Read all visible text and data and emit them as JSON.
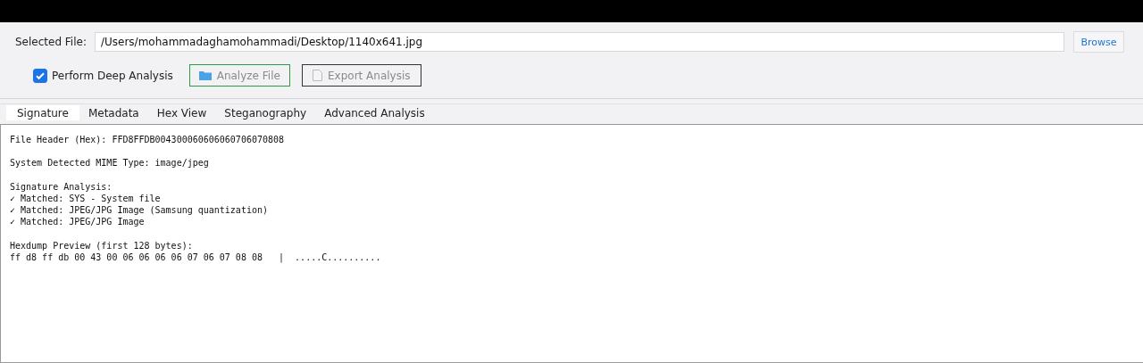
{
  "file_row": {
    "label": "Selected File:",
    "value": "/Users/mohammadaghamohammadi/Desktop/1140x641.jpg",
    "browse_button": "Browse"
  },
  "options_row": {
    "deep_analysis": {
      "label": "Perform Deep Analysis",
      "checked": true
    },
    "buttons": [
      {
        "label": "Analyze File",
        "kind": "analyze"
      },
      {
        "label": "Export Analysis",
        "kind": "export"
      }
    ]
  },
  "tabs": [
    {
      "label": "Signature",
      "selected": true
    },
    {
      "label": "Metadata",
      "selected": false
    },
    {
      "label": "Hex View",
      "selected": false
    },
    {
      "label": "Steganography",
      "selected": false
    },
    {
      "label": "Advanced Analysis",
      "selected": false
    }
  ],
  "output": {
    "blocks": [
      [
        "File Header (Hex): FFD8FFDB004300060606060706070808"
      ],
      [
        "System Detected MIME Type: image/jpeg"
      ],
      [
        "Signature Analysis:",
        "✓ Matched: SYS - System file",
        "✓ Matched: JPEG/JPG Image (Samsung quantization)",
        "✓ Matched: JPEG/JPG Image"
      ],
      [
        "Hexdump Preview (first 128 bytes):",
        "ff d8 ff db 00 43 00 06 06 06 06 07 06 07 08 08   |  .....C.........."
      ]
    ]
  }
}
